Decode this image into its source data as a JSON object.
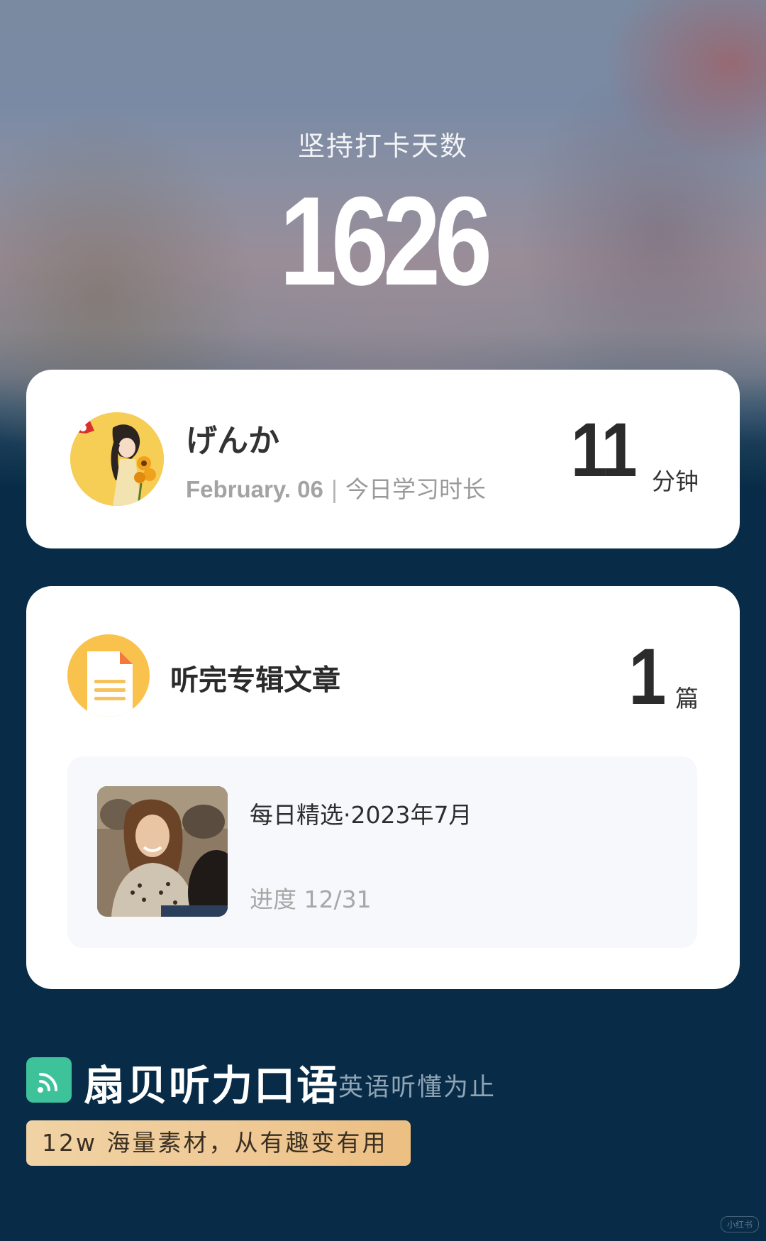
{
  "streak": {
    "label": "坚持打卡天数",
    "days": "1626"
  },
  "profile": {
    "username": "げんか",
    "date": "February. 06",
    "date_separator": "|",
    "today_label": "今日学习时长",
    "minutes": "11",
    "minutes_unit": "分钟"
  },
  "album": {
    "title": "听完专辑文章",
    "count": "1",
    "count_unit": "篇",
    "item": {
      "title": "每日精选·2023年7月",
      "progress": "进度 12/31"
    }
  },
  "brand": {
    "name": "扇贝听力口语",
    "slogan": "英语听懂为止",
    "tagline": "12w 海量素材，从有趣变有用",
    "accent_color": "#3ec29a"
  },
  "watermark": "小红书",
  "colors": {
    "background": "#082c47",
    "card": "#ffffff",
    "doc_icon": "#f9c24c"
  }
}
